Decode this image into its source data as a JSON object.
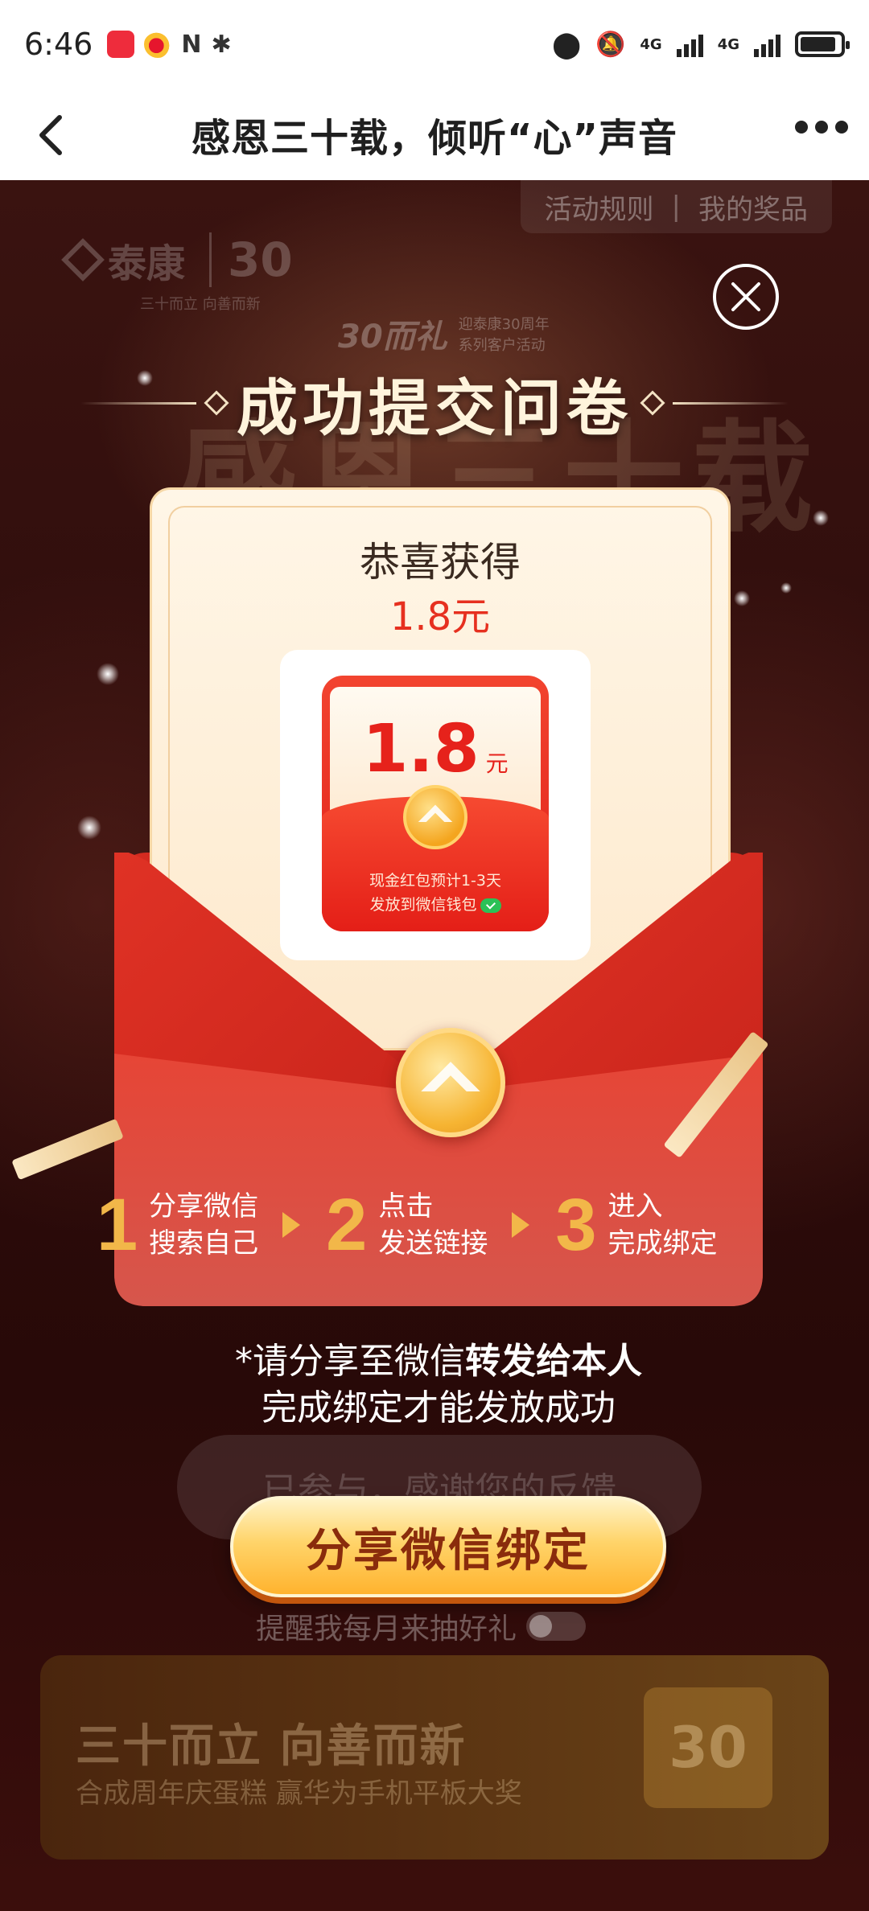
{
  "status_bar": {
    "time": "6:46",
    "network1": "4G",
    "network2": "4G"
  },
  "nav": {
    "title": "感恩三十载，倾听“心”声音"
  },
  "top_links": {
    "rules": "活动规则",
    "separator": "|",
    "my_prizes": "我的奖品"
  },
  "brand": {
    "name": "泰康",
    "number": "30",
    "slogan": "三十而立 向善而新"
  },
  "sub_logo": {
    "mark": "30而礼",
    "caption": "迎泰康30周年 系列客户活动"
  },
  "success_title": "成功提交问卷",
  "background_text": "感恩三十载",
  "card": {
    "congrats": "恭喜获得",
    "amount": "1.8元"
  },
  "packet": {
    "value": "1.8",
    "unit": "元",
    "note_line1": "现金红包预计1-3天",
    "note_line2": "发放到微信钱包"
  },
  "envelope": {
    "text_prefix": "*请分享至微信",
    "text_bold": "转发给本人",
    "text_line2": "完成绑定才能发放成功"
  },
  "steps": [
    {
      "num": "1",
      "line1": "分享微信",
      "line2": "搜索自己"
    },
    {
      "num": "2",
      "line1": "点击",
      "line2": "发送链接"
    },
    {
      "num": "3",
      "line1": "进入",
      "line2": "完成绑定"
    }
  ],
  "ghost_button": "已参与，感谢您的反馈",
  "share_button": "分享微信绑定",
  "remind": {
    "label": "提醒我每月来抽好礼",
    "enabled": false
  },
  "banner": {
    "title": "三十而立 向善而新",
    "subtitle": "合成周年庆蛋糕 赢华为手机平板大奖",
    "gift_text": "30"
  },
  "colors": {
    "accent_red": "#e6301f",
    "gold": "#f2b749",
    "button_text": "#8a2c0c"
  }
}
